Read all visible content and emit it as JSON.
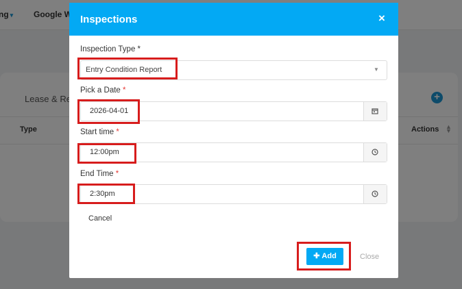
{
  "top_nav": {
    "item1_label": "ng",
    "item2_label": "Google WS"
  },
  "background": {
    "card_title": "Lease & Re",
    "table_headers": {
      "type": "Type",
      "actions": "Actions"
    },
    "add_icon": "plus-circle-icon",
    "sort_icon": "sort-icon"
  },
  "modal": {
    "title": "Inspections",
    "close_glyph": "×",
    "fields": {
      "inspection_type": {
        "label": "Inspection Type *",
        "value": "Entry Condition Report"
      },
      "date": {
        "label": "Pick a Date",
        "required_mark": "*",
        "value": "2026-04-01",
        "icon": "calendar-icon"
      },
      "start_time": {
        "label": "Start time",
        "required_mark": "*",
        "value": "12:00pm",
        "icon": "clock-icon"
      },
      "end_time": {
        "label": "End Time",
        "required_mark": "*",
        "value": "2:30pm",
        "icon": "clock-icon"
      }
    },
    "cancel_label": "Cancel",
    "add_button_label": "Add",
    "close_button_label": "Close"
  },
  "colors": {
    "modal_header": "#03a9f4",
    "highlight_box": "#d71c1c",
    "required_asterisk": "#e53935"
  }
}
